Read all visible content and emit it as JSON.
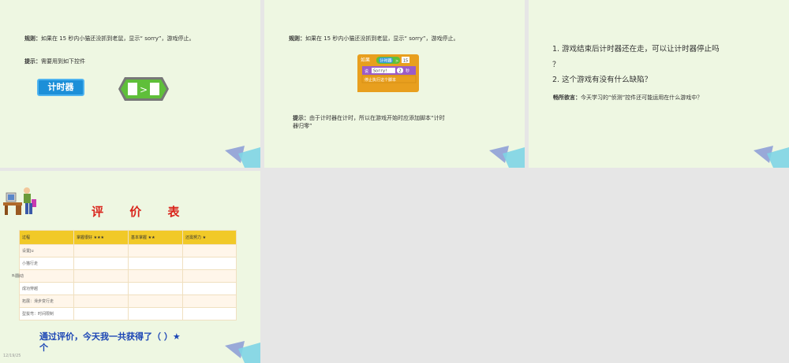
{
  "slide1": {
    "rule_label": "规则：",
    "rule_text": "如果在 15 秒内小猫还没抓到老鼠，显示“ sorry”，游戏停止。",
    "hint_label": "提示：",
    "hint_text": "需要用到如下控件",
    "timer_block": "计时器",
    "compare_op": ">"
  },
  "slide2": {
    "rule_label": "规则：",
    "rule_text": "如果在 15 秒内小猫还没抓到老鼠，显示“ sorry”，游戏停止。",
    "script": {
      "if_label": "如果",
      "timer": "计时器",
      "op": ">",
      "num": "15",
      "say": "说",
      "say_text": "Sorry!",
      "secs": "2",
      "secs_unit": "秒",
      "stop": "停止执行这个脚本"
    },
    "hint_label": "提示：",
    "hint_line1": "由于计时器在计时，所以在游戏开始时应添加脚本“计时",
    "hint_line2": "器归零”"
  },
  "slide3": {
    "q1_line1": "1. 游戏结束后计时器还在走，可以让计时器停止吗",
    "q1_line2": "？",
    "q2": "2. 这个游戏有没有什么缺陷？",
    "chat_label": "畅所欲言：",
    "chat_text": "今天学习的“侦测”控件还可能运用在什么游戏中？"
  },
  "slide4": {
    "title": "评 价 表",
    "headers": [
      "过程",
      "掌握很好 ★★★",
      "基本掌握 ★★",
      "还需努力 ★"
    ],
    "rows": [
      "设置Ju",
      "小猫行走",
      "",
      "成功穿越",
      "拓展：滑步变行走",
      "型拔弯：时间限制"
    ],
    "side_word": "叫翻动",
    "summary_line1": "通过评价，今天我一共获得了（ ）★",
    "summary_line2": "个",
    "date": "12/19/25"
  },
  "colors": {
    "slide_bg": "#eef7e2",
    "title_red": "#d9241b",
    "summary_blue": "#1b45b5",
    "header_yellow": "#f1c928",
    "timer_blue": "#1c8fd8",
    "block_green": "#5fbf3a"
  }
}
